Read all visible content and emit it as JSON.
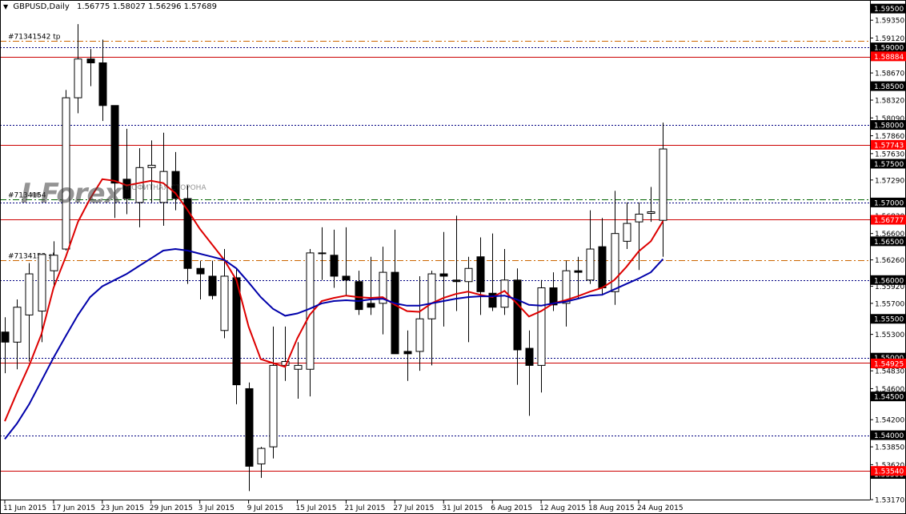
{
  "header": {
    "symbol": "GBPUSD,Daily",
    "quote": "1.56775 1.58027 1.56296 1.57689"
  },
  "watermark": {
    "text": "I-Forex",
    "subtext": "ПРОФИТНАЯ СТОРОНА"
  },
  "colors": {
    "up_candle": "#ffffff",
    "down_candle": "#000000",
    "ma_fast": "#dd0000",
    "ma_slow": "#0000aa",
    "level_red": "#cc0000",
    "level_dotted": "#000080",
    "level_orange": "#cc6600",
    "level_green": "#006400",
    "label_red_bg": "#ff0000"
  },
  "chart_data": {
    "type": "candlestick",
    "ylim": [
      1.5317,
      1.596
    ],
    "yticks": [
      "1.59500",
      "1.59350",
      "1.59120",
      "1.58900",
      "1.58670",
      "1.58500",
      "1.58320",
      "1.58090",
      "1.57860",
      "1.57630",
      "1.57500",
      "1.57290",
      "1.57000",
      "1.56830",
      "1.56600",
      "1.56500",
      "1.56260",
      "1.56000",
      "1.55920",
      "1.55700",
      "1.55500",
      "1.55300",
      "1.55000",
      "1.54830",
      "1.54600",
      "1.54500",
      "1.54200",
      "1.54000",
      "1.53850",
      "1.53620",
      "1.53500",
      "1.53170"
    ],
    "x_labels": [
      "11 Jun 2015",
      "17 Jun 2015",
      "23 Jun 2015",
      "29 Jun 2015",
      "3 Jul 2015",
      "9 Jul 2015",
      "15 Jul 2015",
      "21 Jul 2015",
      "27 Jul 2015",
      "31 Jul 2015",
      "6 Aug 2015",
      "12 Aug 2015",
      "18 Aug 2015",
      "24 Aug 2015"
    ],
    "candles": [
      {
        "o": 1.5533,
        "h": 1.5552,
        "l": 1.548,
        "c": 1.552
      },
      {
        "o": 1.552,
        "h": 1.5575,
        "l": 1.5485,
        "c": 1.5565
      },
      {
        "o": 1.5555,
        "h": 1.5622,
        "l": 1.5495,
        "c": 1.5608
      },
      {
        "o": 1.556,
        "h": 1.5615,
        "l": 1.552,
        "c": 1.5633
      },
      {
        "o": 1.5612,
        "h": 1.565,
        "l": 1.559,
        "c": 1.5632
      },
      {
        "o": 1.564,
        "h": 1.5845,
        "l": 1.5638,
        "c": 1.5835
      },
      {
        "o": 1.5835,
        "h": 1.593,
        "l": 1.5815,
        "c": 1.5885
      },
      {
        "o": 1.5885,
        "h": 1.5898,
        "l": 1.585,
        "c": 1.588
      },
      {
        "o": 1.588,
        "h": 1.591,
        "l": 1.5805,
        "c": 1.5825
      },
      {
        "o": 1.5825,
        "h": 1.5822,
        "l": 1.568,
        "c": 1.5725
      },
      {
        "o": 1.573,
        "h": 1.5795,
        "l": 1.5685,
        "c": 1.5705
      },
      {
        "o": 1.57,
        "h": 1.577,
        "l": 1.5668,
        "c": 1.5745
      },
      {
        "o": 1.5745,
        "h": 1.578,
        "l": 1.57,
        "c": 1.5748
      },
      {
        "o": 1.57,
        "h": 1.579,
        "l": 1.567,
        "c": 1.574
      },
      {
        "o": 1.574,
        "h": 1.5765,
        "l": 1.569,
        "c": 1.5705
      },
      {
        "o": 1.5705,
        "h": 1.5722,
        "l": 1.5595,
        "c": 1.5615
      },
      {
        "o": 1.5615,
        "h": 1.5625,
        "l": 1.5575,
        "c": 1.5608
      },
      {
        "o": 1.5605,
        "h": 1.5625,
        "l": 1.5575,
        "c": 1.558
      },
      {
        "o": 1.5535,
        "h": 1.564,
        "l": 1.5525,
        "c": 1.5605
      },
      {
        "o": 1.5603,
        "h": 1.5615,
        "l": 1.544,
        "c": 1.5465
      },
      {
        "o": 1.546,
        "h": 1.5468,
        "l": 1.5328,
        "c": 1.536
      },
      {
        "o": 1.5363,
        "h": 1.5385,
        "l": 1.5345,
        "c": 1.5383
      },
      {
        "o": 1.5385,
        "h": 1.554,
        "l": 1.537,
        "c": 1.549
      },
      {
        "o": 1.549,
        "h": 1.554,
        "l": 1.547,
        "c": 1.5495
      },
      {
        "o": 1.5485,
        "h": 1.552,
        "l": 1.5447,
        "c": 1.549
      },
      {
        "o": 1.5485,
        "h": 1.564,
        "l": 1.545,
        "c": 1.5635
      },
      {
        "o": 1.5635,
        "h": 1.5668,
        "l": 1.56,
        "c": 1.5635
      },
      {
        "o": 1.5632,
        "h": 1.5665,
        "l": 1.559,
        "c": 1.5605
      },
      {
        "o": 1.5605,
        "h": 1.5668,
        "l": 1.558,
        "c": 1.56
      },
      {
        "o": 1.5598,
        "h": 1.5612,
        "l": 1.5555,
        "c": 1.5562
      },
      {
        "o": 1.557,
        "h": 1.563,
        "l": 1.5555,
        "c": 1.5565
      },
      {
        "o": 1.557,
        "h": 1.5643,
        "l": 1.553,
        "c": 1.561
      },
      {
        "o": 1.561,
        "h": 1.5665,
        "l": 1.552,
        "c": 1.5505
      },
      {
        "o": 1.5508,
        "h": 1.5535,
        "l": 1.547,
        "c": 1.5505
      },
      {
        "o": 1.5508,
        "h": 1.5605,
        "l": 1.5483,
        "c": 1.555
      },
      {
        "o": 1.555,
        "h": 1.5612,
        "l": 1.549,
        "c": 1.5608
      },
      {
        "o": 1.5608,
        "h": 1.5662,
        "l": 1.554,
        "c": 1.5605
      },
      {
        "o": 1.56,
        "h": 1.5683,
        "l": 1.556,
        "c": 1.5598
      },
      {
        "o": 1.5598,
        "h": 1.563,
        "l": 1.552,
        "c": 1.5615
      },
      {
        "o": 1.563,
        "h": 1.5655,
        "l": 1.5555,
        "c": 1.5585
      },
      {
        "o": 1.5583,
        "h": 1.566,
        "l": 1.556,
        "c": 1.5565
      },
      {
        "o": 1.5565,
        "h": 1.564,
        "l": 1.5555,
        "c": 1.56
      },
      {
        "o": 1.56,
        "h": 1.5615,
        "l": 1.5465,
        "c": 1.551
      },
      {
        "o": 1.5512,
        "h": 1.5535,
        "l": 1.5425,
        "c": 1.549
      },
      {
        "o": 1.549,
        "h": 1.56,
        "l": 1.5455,
        "c": 1.559
      },
      {
        "o": 1.559,
        "h": 1.561,
        "l": 1.556,
        "c": 1.5568
      },
      {
        "o": 1.557,
        "h": 1.5625,
        "l": 1.554,
        "c": 1.5612
      },
      {
        "o": 1.5612,
        "h": 1.563,
        "l": 1.5575,
        "c": 1.561
      },
      {
        "o": 1.56,
        "h": 1.569,
        "l": 1.5595,
        "c": 1.564
      },
      {
        "o": 1.5643,
        "h": 1.568,
        "l": 1.558,
        "c": 1.559
      },
      {
        "o": 1.5585,
        "h": 1.5715,
        "l": 1.5568,
        "c": 1.566
      },
      {
        "o": 1.565,
        "h": 1.57,
        "l": 1.564,
        "c": 1.5673
      },
      {
        "o": 1.5675,
        "h": 1.57,
        "l": 1.5613,
        "c": 1.5685
      },
      {
        "o": 1.5686,
        "h": 1.572,
        "l": 1.5675,
        "c": 1.5688
      },
      {
        "o": 1.5677,
        "h": 1.5803,
        "l": 1.563,
        "c": 1.5769
      }
    ],
    "series": [
      {
        "name": "",
        "color": "#dd0000",
        "values": [
          1.5418,
          1.5455,
          1.549,
          1.553,
          1.559,
          1.563,
          1.5675,
          1.5705,
          1.573,
          1.5728,
          1.5722,
          1.5725,
          1.5728,
          1.5725,
          1.5712,
          1.569,
          1.5666,
          1.5646,
          1.5626,
          1.56,
          1.554,
          1.5498,
          1.5493,
          1.5488,
          1.5525,
          1.5555,
          1.5573,
          1.5577,
          1.558,
          1.5578,
          1.5577,
          1.5578,
          1.5568,
          1.556,
          1.5559,
          1.557,
          1.5577,
          1.5582,
          1.5585,
          1.5581,
          1.5578,
          1.5586,
          1.557,
          1.5553,
          1.556,
          1.557,
          1.5574,
          1.5579,
          1.5585,
          1.559,
          1.56,
          1.5617,
          1.5637,
          1.565,
          1.5676
        ]
      },
      {
        "name": "",
        "color": "#0000aa",
        "values": [
          1.5395,
          1.5415,
          1.544,
          1.547,
          1.55,
          1.5528,
          1.5555,
          1.5578,
          1.5592,
          1.56,
          1.5608,
          1.5618,
          1.5628,
          1.5638,
          1.564,
          1.5638,
          1.5634,
          1.563,
          1.5626,
          1.5615,
          1.5597,
          1.5578,
          1.5563,
          1.5554,
          1.5557,
          1.5563,
          1.557,
          1.5573,
          1.5574,
          1.5573,
          1.5575,
          1.5576,
          1.557,
          1.5567,
          1.5567,
          1.557,
          1.5573,
          1.5576,
          1.5578,
          1.5579,
          1.5579,
          1.558,
          1.5575,
          1.5568,
          1.5567,
          1.557,
          1.5572,
          1.5576,
          1.558,
          1.5581,
          1.5588,
          1.5595,
          1.5602,
          1.561,
          1.5627
        ]
      }
    ],
    "levels": [
      {
        "price": 1.59,
        "style": "dotted-blue",
        "label": "1.59000",
        "label_style": "dark"
      },
      {
        "price": 1.5888,
        "style": "solid-red",
        "label": "1.58884",
        "label_style": "red"
      },
      {
        "price": 1.58,
        "style": "dotted-blue",
        "label": "1.58000",
        "label_style": "dark"
      },
      {
        "price": 1.5774,
        "style": "solid-red",
        "label": "1.57743",
        "label_style": "red"
      },
      {
        "price": 1.57,
        "style": "dotted-blue",
        "label": "1.57000",
        "label_style": "dark"
      },
      {
        "price": 1.5678,
        "style": "solid-red",
        "label": "1.56777",
        "label_style": "red"
      },
      {
        "price": 1.56,
        "style": "dotted-blue",
        "label": "1.56000",
        "label_style": "dark"
      },
      {
        "price": 1.55,
        "style": "dotted-blue",
        "label": "1.55000",
        "label_style": "dark"
      },
      {
        "price": 1.5493,
        "style": "solid-red",
        "label": "1.54925",
        "label_style": "red"
      },
      {
        "price": 1.54,
        "style": "dotted-blue",
        "label": "1.54000",
        "label_style": "dark"
      },
      {
        "price": 1.5354,
        "style": "solid-red",
        "label": "1.53540",
        "label_style": "red"
      }
    ],
    "dark_labels": [
      "1.59500",
      "1.58500",
      "1.57500",
      "1.56500",
      "1.55500",
      "1.54500",
      "1.53500"
    ],
    "order_lines": [
      {
        "price": 1.5908,
        "style": "dashdot-orange",
        "label": "#71341542 tp"
      },
      {
        "price": 1.5704,
        "style": "dashdot-green",
        "label": "#7134154"
      },
      {
        "price": 1.5626,
        "style": "dashdot-orange",
        "label": "#7134152 sl"
      }
    ]
  }
}
